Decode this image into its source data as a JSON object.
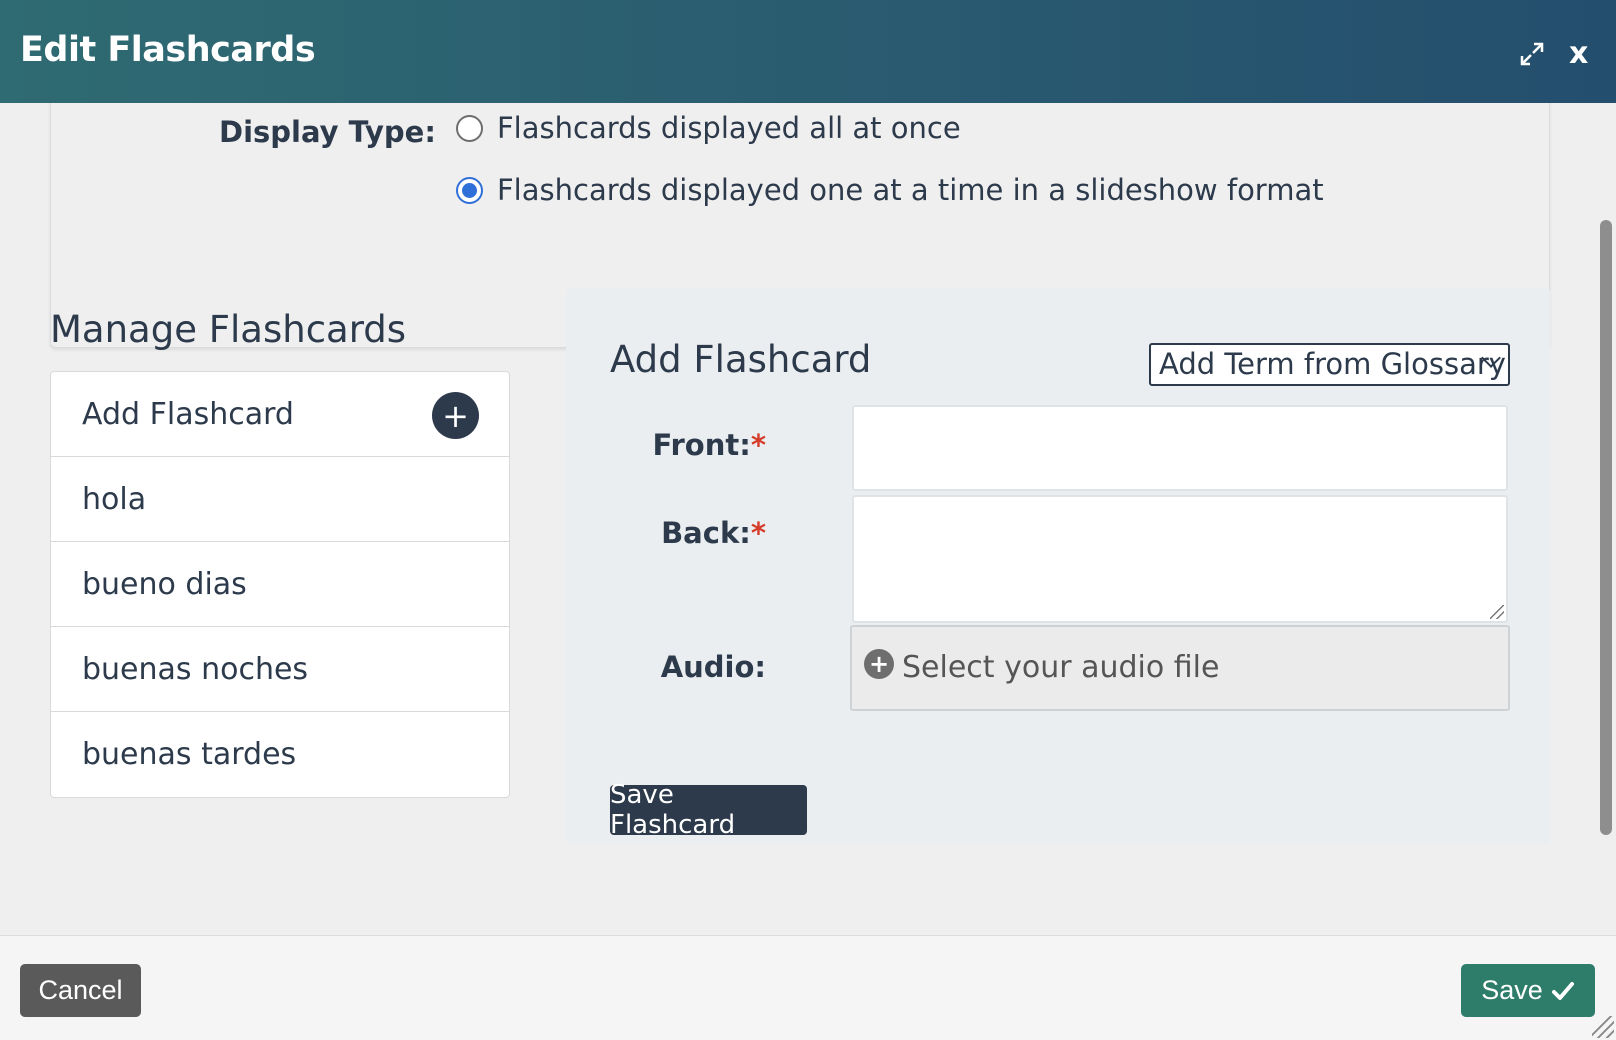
{
  "dialog": {
    "title": "Edit Flashcards",
    "close_label": "x"
  },
  "display_type": {
    "label": "Display Type:",
    "options": [
      {
        "label": "Flashcards displayed all at once",
        "checked": false
      },
      {
        "label": "Flashcards displayed one at a time in a slideshow format",
        "checked": true
      }
    ]
  },
  "manage": {
    "title": "Manage Flashcards",
    "add_label": "Add Flashcard",
    "add_button_label": "+",
    "items": [
      "hola",
      "bueno dias",
      "buenas noches",
      "buenas tardes"
    ]
  },
  "add_form": {
    "title": "Add Flashcard",
    "glossary_select": "Add Term from Glossary",
    "front_label": "Front:",
    "back_label": "Back:",
    "required_marker": "*",
    "front_value": "",
    "back_value": "",
    "audio_label": "Audio:",
    "audio_button_icon": "+",
    "audio_placeholder": "Select your audio file",
    "save_button": "Save Flashcard"
  },
  "footer": {
    "cancel_label": "Cancel",
    "save_label": "Save"
  },
  "colors": {
    "header_start": "#2f6b72",
    "header_end": "#244e6e",
    "dark_navy": "#2d3a4b",
    "save_green": "#2e7d6a",
    "radio_blue": "#2f6fd8",
    "required_red": "#d53c2b"
  }
}
